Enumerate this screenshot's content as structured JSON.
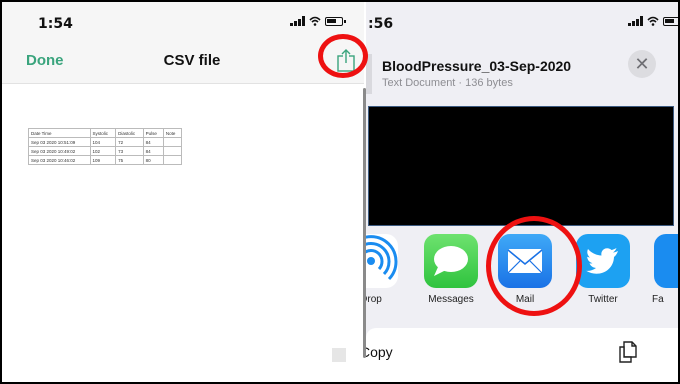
{
  "left": {
    "status": {
      "time": "1:54"
    },
    "nav": {
      "done_label": "Done",
      "title": "CSV file"
    },
    "table": {
      "headers": [
        "Date Time",
        "Systolic",
        "Diastolic",
        "Pulse",
        "Note"
      ],
      "rows": [
        [
          "Sep 03 2020 10:51:09",
          "104",
          "72",
          "84",
          ""
        ],
        [
          "Sep 03 2020 10:49:02",
          "102",
          "73",
          "84",
          ""
        ],
        [
          "Sep 03 2020 10:46:02",
          "109",
          "75",
          "80",
          ""
        ]
      ]
    }
  },
  "right": {
    "status": {
      "time": ":56"
    },
    "sheet": {
      "title": "BloodPressure_03-Sep-2020",
      "subtitle": "Text Document · 136 bytes",
      "close_symbol": "✕"
    },
    "apps": [
      {
        "label": "Drop",
        "icon": "airdrop-icon"
      },
      {
        "label": "Messages",
        "icon": "messages-icon"
      },
      {
        "label": "Mail",
        "icon": "mail-icon"
      },
      {
        "label": "Twitter",
        "icon": "twitter-icon"
      },
      {
        "label": "Fa",
        "icon": "app-icon"
      }
    ],
    "actions": {
      "copy_label": "Copy"
    }
  },
  "colors": {
    "accent_green": "#3aa47d",
    "highlight_red": "#ee1111",
    "mail_blue": "#1a72e6",
    "twitter_blue": "#1da1f2",
    "messages_green": "#2fc33e"
  }
}
